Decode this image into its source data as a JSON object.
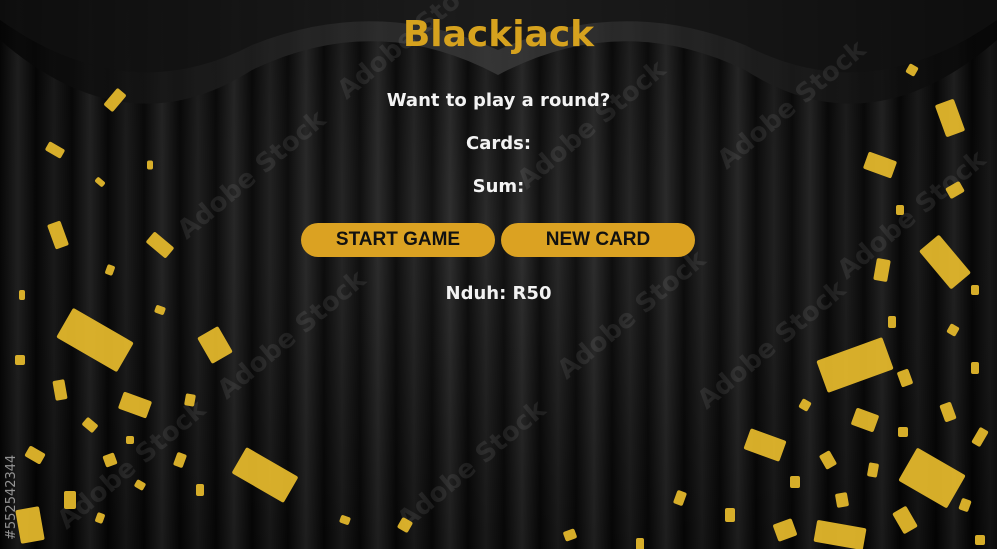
{
  "game": {
    "title": "Blackjack",
    "message": "Want to play a round?",
    "cards_label": "Cards:",
    "cards_value": "",
    "sum_label": "Sum:",
    "sum_value": "",
    "start_button_label": "START GAME",
    "new_card_button_label": "NEW CARD",
    "player_label": "Nduh: R50"
  },
  "background": {
    "stock_id": "#552542344",
    "watermark_text": "Adobe Stock"
  },
  "colors": {
    "title": "#d6a21e",
    "button_bg": "#dba222",
    "button_text": "#111111",
    "text": "#f3f3f3",
    "confetti": "#e8bc2c"
  }
}
